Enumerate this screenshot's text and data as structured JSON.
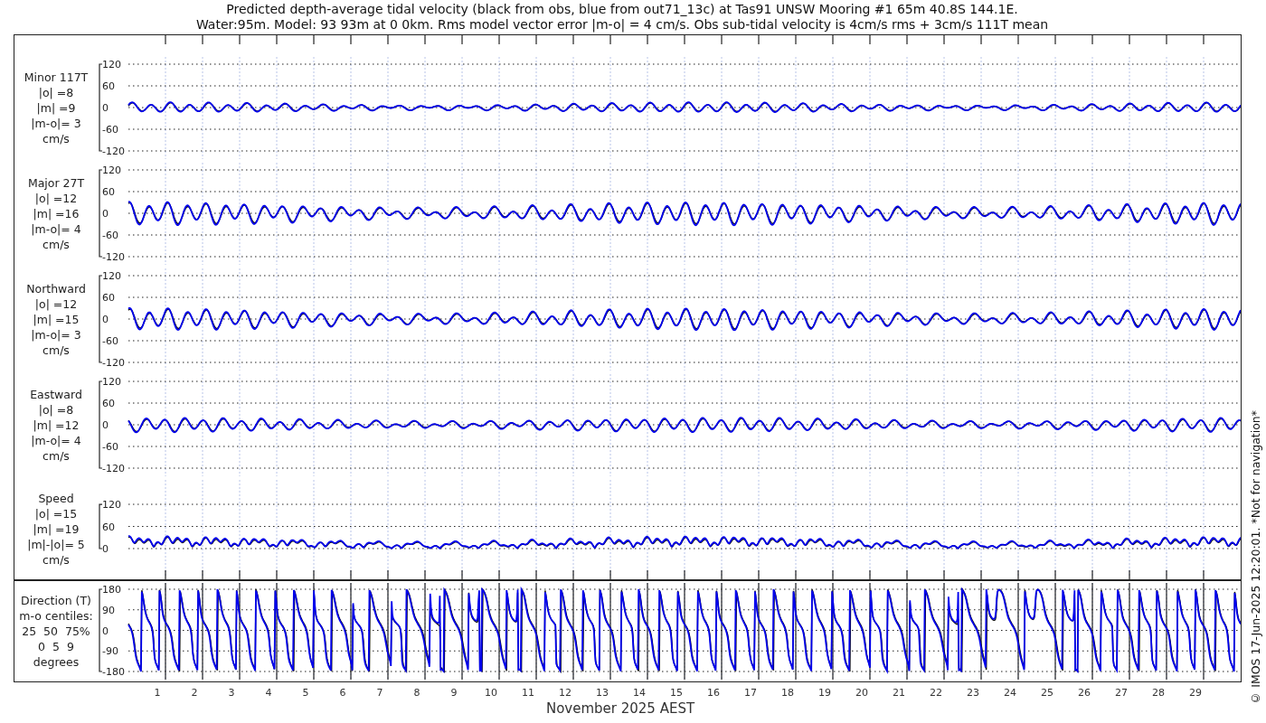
{
  "title_lines": [
    "Predicted depth-average tidal velocity (black from obs, blue from out71_13c) at Tas91 UNSW Mooring #1 65m 40.8S 144.1E.",
    "Water:95m. Model: 93 93m at 0 0km. Rms model vector error |m-o| = 4 cm/s. Obs sub-tidal velocity is 4cm/s rms + 3cm/s 111T mean"
  ],
  "panels": [
    {
      "kind": "velocity",
      "label_lines": [
        "Minor 117T",
        "|o| =8",
        "|m| =9",
        "|m-o|= 3",
        "cm/s"
      ],
      "yticks": [
        "120",
        "60",
        "0",
        "-60",
        "-120"
      ]
    },
    {
      "kind": "velocity",
      "label_lines": [
        "Major 27T",
        "|o| =12",
        "|m| =16",
        "|m-o|= 4",
        "cm/s"
      ],
      "yticks": [
        "120",
        "60",
        "0",
        "-60",
        "-120"
      ]
    },
    {
      "kind": "velocity",
      "label_lines": [
        "Northward",
        "|o| =12",
        "|m| =15",
        "|m-o|= 3",
        "cm/s"
      ],
      "yticks": [
        "120",
        "60",
        "0",
        "-60",
        "-120"
      ]
    },
    {
      "kind": "velocity",
      "label_lines": [
        "Eastward",
        "|o| =8",
        "|m| =12",
        "|m-o|= 4",
        "cm/s"
      ],
      "yticks": [
        "120",
        "60",
        "0",
        "-60",
        "-120"
      ]
    },
    {
      "kind": "speed",
      "label_lines": [
        "Speed",
        "|o| =15",
        "|m| =19",
        "|m|-|o|= 5",
        "cm/s"
      ],
      "yticks": [
        "120",
        "60",
        "0"
      ]
    },
    {
      "kind": "direction",
      "label_lines": [
        "Direction (T)",
        "m-o centiles:",
        "25  50  75%",
        "0  5  9",
        "degrees"
      ],
      "yticks": [
        "180",
        "90",
        "0",
        "-90",
        "-180"
      ]
    }
  ],
  "xticks": [
    "1",
    "2",
    "3",
    "4",
    "5",
    "6",
    "7",
    "8",
    "9",
    "10",
    "11",
    "12",
    "13",
    "14",
    "15",
    "16",
    "17",
    "18",
    "19",
    "20",
    "21",
    "22",
    "23",
    "24",
    "25",
    "26",
    "27",
    "28",
    "29"
  ],
  "xlabel": "November 2025 AEST",
  "credit": "© IMOS 17-Jun-2025 12:20:01. *Not for navigation*"
}
